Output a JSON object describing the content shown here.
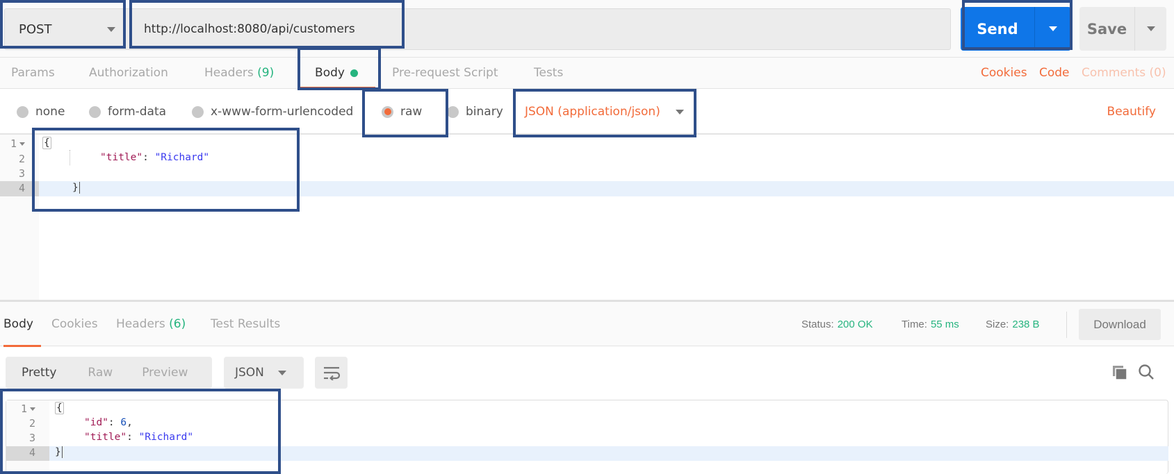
{
  "request": {
    "method": "POST",
    "url": "http://localhost:8080/api/customers",
    "send_label": "Send",
    "save_label": "Save"
  },
  "request_tabs": {
    "items": [
      {
        "label": "Params"
      },
      {
        "label": "Authorization"
      },
      {
        "label": "Headers",
        "count": "(9)"
      },
      {
        "label": "Body",
        "active": true
      },
      {
        "label": "Pre-request Script"
      },
      {
        "label": "Tests"
      }
    ],
    "links": {
      "cookies": "Cookies",
      "code": "Code",
      "comments": "Comments (0)"
    }
  },
  "body_type": {
    "options": [
      {
        "label": "none",
        "selected": false
      },
      {
        "label": "form-data",
        "selected": false
      },
      {
        "label": "x-www-form-urlencoded",
        "selected": false
      },
      {
        "label": "raw",
        "selected": true
      },
      {
        "label": "binary",
        "selected": false
      }
    ],
    "content_type": "JSON (application/json)",
    "beautify_label": "Beautify"
  },
  "request_body": {
    "line_numbers": [
      "1",
      "2",
      "3",
      "4"
    ],
    "lines": {
      "l1": "{",
      "l2_key": "\"title\"",
      "l2_colon": ": ",
      "l2_value": "\"Richard\"",
      "l4": "}"
    }
  },
  "response_tabs": {
    "items": [
      {
        "label": "Body",
        "active": true
      },
      {
        "label": "Cookies"
      },
      {
        "label": "Headers",
        "count": "(6)"
      },
      {
        "label": "Test Results"
      }
    ]
  },
  "response_meta": {
    "status_label": "Status:",
    "status_value": "200 OK",
    "time_label": "Time:",
    "time_value": "55 ms",
    "size_label": "Size:",
    "size_value": "238 B",
    "download_label": "Download"
  },
  "response_view": {
    "modes": [
      "Pretty",
      "Raw",
      "Preview"
    ],
    "selected_mode": "Pretty",
    "format": "JSON"
  },
  "response_body": {
    "line_numbers": [
      "1",
      "2",
      "3",
      "4"
    ],
    "lines": {
      "l1": "{",
      "l2_key": "\"id\"",
      "l2_colon": ": ",
      "l2_value": "6",
      "l2_comma": ",",
      "l3_key": "\"title\"",
      "l3_colon": ": ",
      "l3_value": "\"Richard\"",
      "l4": "}"
    }
  },
  "colors": {
    "accent_orange": "#f26b3a",
    "send_blue": "#0f76e8",
    "success_green": "#26b47f",
    "annotation_box": "#2f4f8a"
  }
}
